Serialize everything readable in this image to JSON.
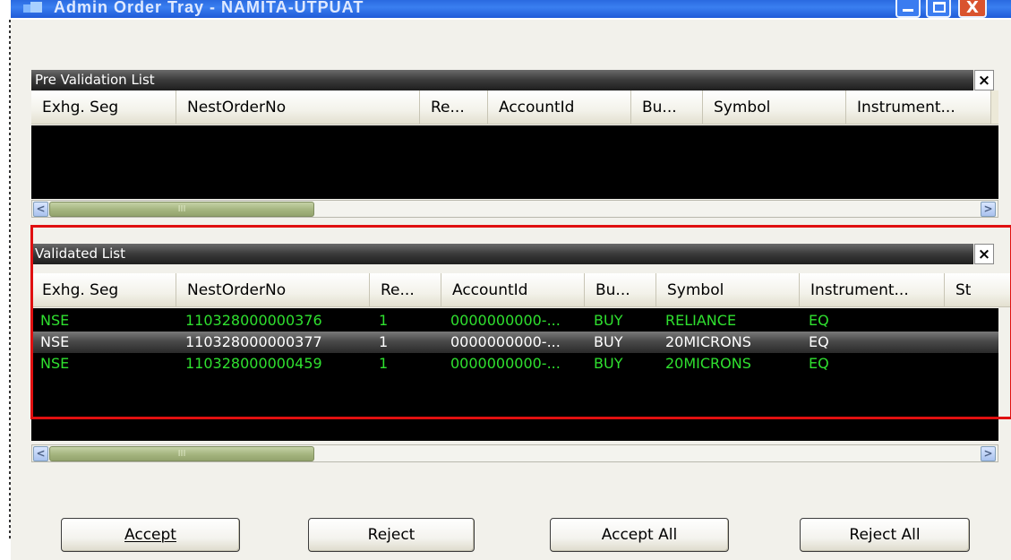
{
  "window": {
    "title": "Admin Order Tray - NAMITA-UTPUAT",
    "minimize_icon": "minimize-icon",
    "maximize_icon": "maximize-icon",
    "close_icon": "close-icon",
    "close_glyph": "X"
  },
  "pre_validation": {
    "title": "Pre Validation List",
    "close_glyph": "×",
    "columns": [
      "Exhg. Seg",
      "NestOrderNo",
      "Re...",
      "AccountId",
      "Bu...",
      "Symbol",
      "Instrument..."
    ],
    "rows": []
  },
  "validated": {
    "title": "Validated List",
    "close_glyph": "×",
    "columns": [
      "Exhg. Seg",
      "NestOrderNo",
      "Re...",
      "AccountId",
      "Bu...",
      "Symbol",
      "Instrument...",
      "St"
    ],
    "rows": [
      {
        "seg": "NSE",
        "order_no": "110328000000376",
        "re": "1",
        "account": "0000000000-...",
        "buy": "BUY",
        "symbol": "RELIANCE",
        "instrument": "EQ",
        "state": "green"
      },
      {
        "seg": "NSE",
        "order_no": "110328000000377",
        "re": "1",
        "account": "0000000000-...",
        "buy": "BUY",
        "symbol": "20MICRONS",
        "instrument": "EQ",
        "state": "selected"
      },
      {
        "seg": "NSE",
        "order_no": "110328000000459",
        "re": "1",
        "account": "0000000000-...",
        "buy": "BUY",
        "symbol": "20MICRONS",
        "instrument": "EQ",
        "state": "green"
      }
    ]
  },
  "scrollbar": {
    "left_glyph": "<",
    "right_glyph": ">",
    "thumb_grip": "III"
  },
  "buttons": {
    "accept": "Accept",
    "reject": "Reject",
    "accept_all": "Accept All",
    "reject_all": "Reject All"
  },
  "colors": {
    "row_text_green": "#2fe02f",
    "grid_background": "#000000",
    "highlight": "#e01010",
    "title_blue": "#2a6ae0"
  }
}
